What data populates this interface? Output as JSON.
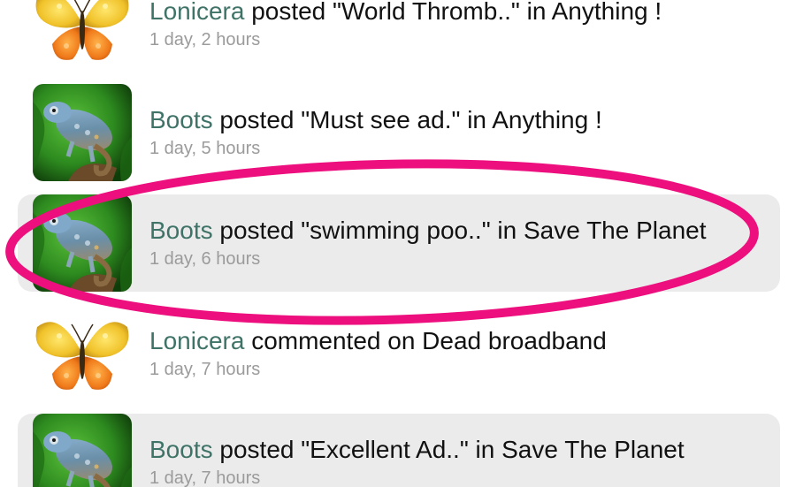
{
  "feed": {
    "items": [
      {
        "user": "Lonicera",
        "action": "posted \"World Thromb..\" in Anything !",
        "time": "1 day, 2 hours",
        "avatar": "butterfly-icon"
      },
      {
        "user": "Boots",
        "action": "posted \"Must see ad.\" in Anything !",
        "time": "1 day, 5 hours",
        "avatar": "chameleon-icon"
      },
      {
        "user": "Boots",
        "action": "posted \"swimming poo..\" in Save The Planet",
        "time": "1 day, 6 hours",
        "avatar": "chameleon-icon"
      },
      {
        "user": "Lonicera",
        "action": "commented on Dead broadband",
        "time": "1 day, 7 hours",
        "avatar": "butterfly-icon"
      },
      {
        "user": "Boots",
        "action": "posted \"Excellent Ad..\" in Save The Planet",
        "time": "1 day, 7 hours",
        "avatar": "chameleon-icon"
      }
    ]
  },
  "annotation": {
    "color": "#ec0f7d",
    "shape": "ellipse",
    "target": "feed-item-3"
  }
}
